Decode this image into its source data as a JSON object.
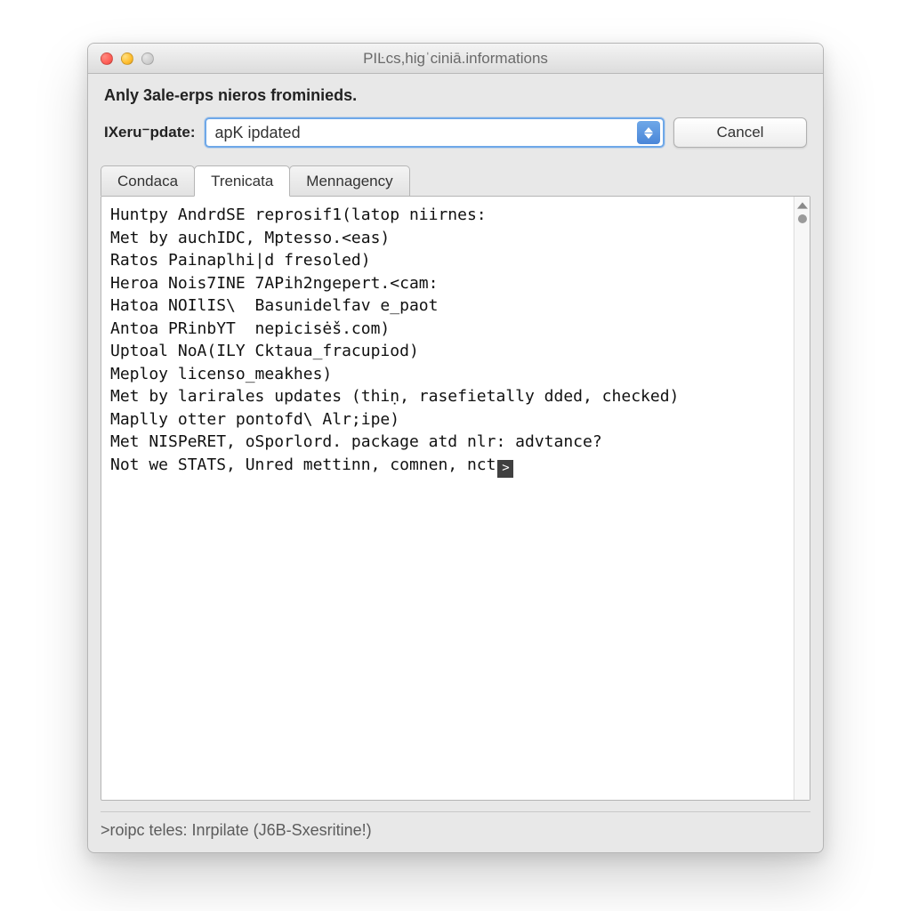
{
  "window": {
    "title": "PIĿcs,higˈciniā.informations"
  },
  "header": {
    "heading": "Anly 3ale-erps nieros frominieds.",
    "field_label": "IXeru⁻pdate:",
    "combo_value": "apK ipdated",
    "cancel_label": "Cancel"
  },
  "tabs": [
    {
      "label": "Condaca",
      "active": false
    },
    {
      "label": "Trenicata",
      "active": true
    },
    {
      "label": "Mennagency",
      "active": false
    }
  ],
  "log_lines": [
    "Huntpy AndrdSE reprosif1(latop niirnes:",
    "Met by auchIDC, Mptesso.<eas)",
    "Ratos Painaplhi|d fresoled)",
    "Heroa Nois7INE 7APih2ngepert.<cam:",
    "Hatoa NOIlIS\\  Basunidelfav e_paot",
    "Antoa PRinbYT  nepicisėš.com)",
    "Uptoal NoA(ILY Cktaua_fracupiod)",
    "Meploy licenso_meakhes)",
    "Met by larirales updates (thiṇ, rasefietally dded, checked)",
    "Maplly otter pontofd\\ Alr;ipe)",
    "Met NISPeRET, oSporlord. package atd nlr: advtance?"
  ],
  "last_line": {
    "prefix": "Not we STATS, Unred mettinn, comnen, nct",
    "cursor_char": ">"
  },
  "status": ">roipc teles: Inrpilate (J6B-Sxesritine!)"
}
